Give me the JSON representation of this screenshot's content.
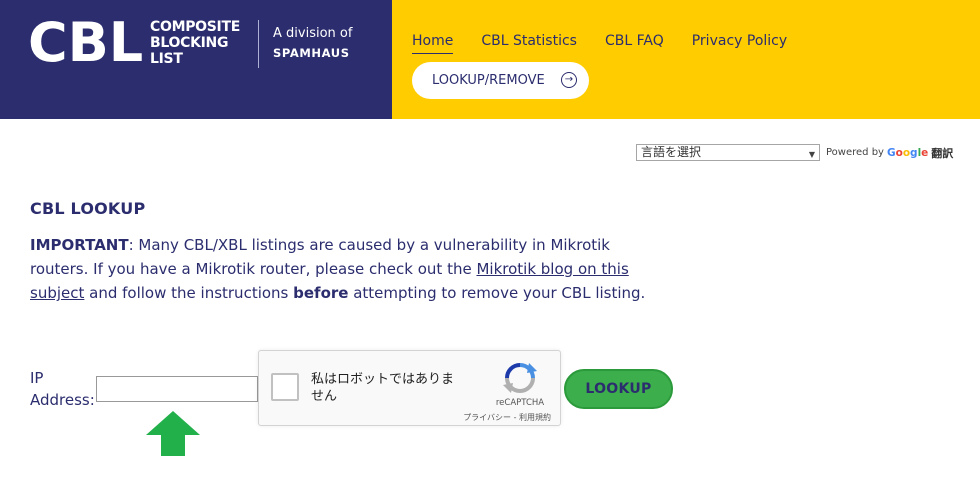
{
  "header": {
    "logo_main": "CBL",
    "logo_lines": [
      "COMPOSITE",
      "BLOCKING",
      "LIST"
    ],
    "division_text": "A division of",
    "division_brand": "SPAMHAUS",
    "nav": [
      {
        "label": "Home",
        "active": true
      },
      {
        "label": "CBL Statistics",
        "active": false
      },
      {
        "label": "CBL FAQ",
        "active": false
      },
      {
        "label": "Privacy Policy",
        "active": false
      }
    ],
    "cta_label": "LOOKUP/REMOVE",
    "cta_icon": "circle-arrow-right-icon"
  },
  "translate": {
    "select_value": "言語を選択",
    "powered_by": "Powered by",
    "google": [
      "G",
      "o",
      "o",
      "g",
      "l",
      "e"
    ],
    "translate_label": "翻訳"
  },
  "main": {
    "title": "CBL LOOKUP",
    "important_label": "IMPORTANT",
    "important_text_1": ": Many CBL/XBL listings are caused by a vulnerability in Mikrotik routers. If you have a Mikrotik router, please check out the ",
    "link_text": "Mikrotik blog on this subject",
    "important_text_2": " and follow the instructions ",
    "before_text": "before",
    "important_text_3": " attempting to remove your CBL listing.",
    "ip_label": "IP Address:",
    "ip_value": "",
    "lookup_button": "LOOKUP"
  },
  "recaptcha": {
    "checkbox_label": "私はロボットではありません",
    "brand": "reCAPTCHA",
    "links": "プライバシー - 利用規約"
  },
  "colors": {
    "brand_navy": "#2b2d6e",
    "nav_yellow": "#ffcc00",
    "lookup_green": "#3cae4c",
    "arrow_green": "#22b04b"
  }
}
